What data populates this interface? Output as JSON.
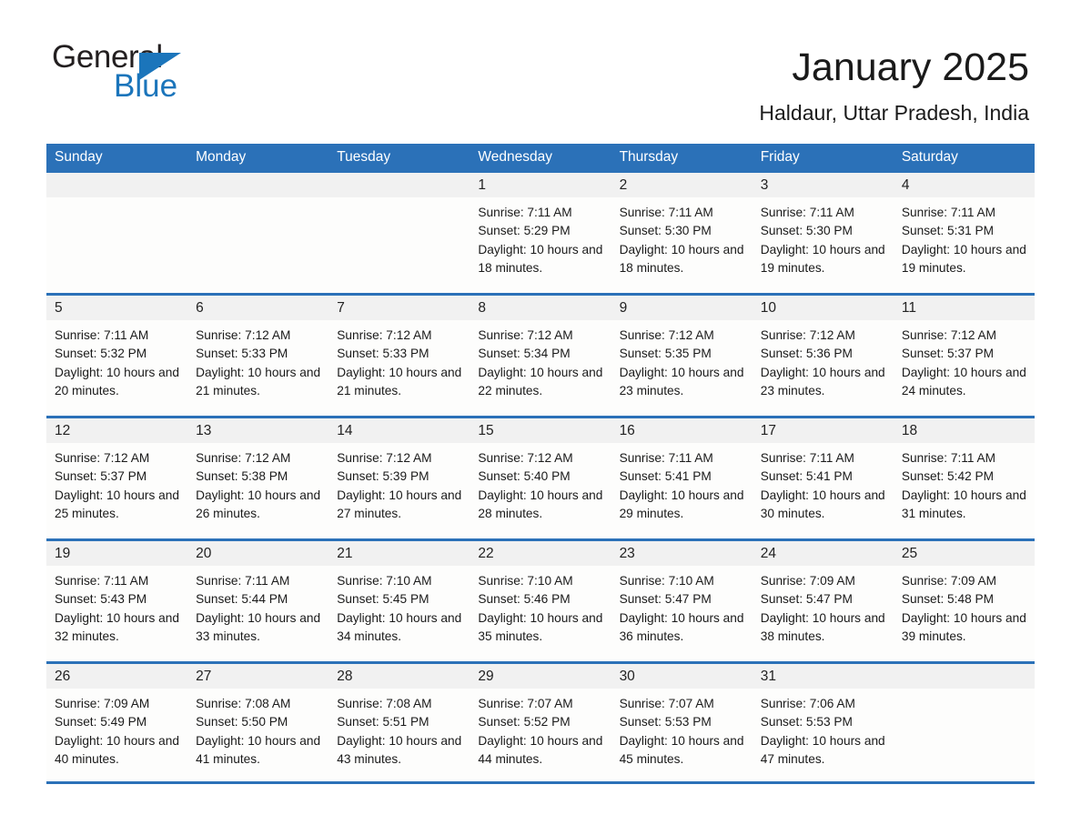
{
  "brand": {
    "name_part1": "General",
    "name_part2": "Blue",
    "logo_icon": "triangle-flag-icon",
    "accent_color": "#1b75bb"
  },
  "header": {
    "month_title": "January 2025",
    "location": "Haldaur, Uttar Pradesh, India"
  },
  "theme": {
    "header_bar_color": "#2b71b8",
    "date_band_color": "#f1f1f1",
    "cell_background": "#fdfdfc",
    "text_color": "#1a1a1a"
  },
  "weekdays": [
    "Sunday",
    "Monday",
    "Tuesday",
    "Wednesday",
    "Thursday",
    "Friday",
    "Saturday"
  ],
  "weeks": [
    [
      {
        "date": "",
        "empty": true
      },
      {
        "date": "",
        "empty": true
      },
      {
        "date": "",
        "empty": true
      },
      {
        "date": "1",
        "sunrise": "Sunrise: 7:11 AM",
        "sunset": "Sunset: 5:29 PM",
        "daylight": "Daylight: 10 hours and 18 minutes."
      },
      {
        "date": "2",
        "sunrise": "Sunrise: 7:11 AM",
        "sunset": "Sunset: 5:30 PM",
        "daylight": "Daylight: 10 hours and 18 minutes."
      },
      {
        "date": "3",
        "sunrise": "Sunrise: 7:11 AM",
        "sunset": "Sunset: 5:30 PM",
        "daylight": "Daylight: 10 hours and 19 minutes."
      },
      {
        "date": "4",
        "sunrise": "Sunrise: 7:11 AM",
        "sunset": "Sunset: 5:31 PM",
        "daylight": "Daylight: 10 hours and 19 minutes."
      }
    ],
    [
      {
        "date": "5",
        "sunrise": "Sunrise: 7:11 AM",
        "sunset": "Sunset: 5:32 PM",
        "daylight": "Daylight: 10 hours and 20 minutes."
      },
      {
        "date": "6",
        "sunrise": "Sunrise: 7:12 AM",
        "sunset": "Sunset: 5:33 PM",
        "daylight": "Daylight: 10 hours and 21 minutes."
      },
      {
        "date": "7",
        "sunrise": "Sunrise: 7:12 AM",
        "sunset": "Sunset: 5:33 PM",
        "daylight": "Daylight: 10 hours and 21 minutes."
      },
      {
        "date": "8",
        "sunrise": "Sunrise: 7:12 AM",
        "sunset": "Sunset: 5:34 PM",
        "daylight": "Daylight: 10 hours and 22 minutes."
      },
      {
        "date": "9",
        "sunrise": "Sunrise: 7:12 AM",
        "sunset": "Sunset: 5:35 PM",
        "daylight": "Daylight: 10 hours and 23 minutes."
      },
      {
        "date": "10",
        "sunrise": "Sunrise: 7:12 AM",
        "sunset": "Sunset: 5:36 PM",
        "daylight": "Daylight: 10 hours and 23 minutes."
      },
      {
        "date": "11",
        "sunrise": "Sunrise: 7:12 AM",
        "sunset": "Sunset: 5:37 PM",
        "daylight": "Daylight: 10 hours and 24 minutes."
      }
    ],
    [
      {
        "date": "12",
        "sunrise": "Sunrise: 7:12 AM",
        "sunset": "Sunset: 5:37 PM",
        "daylight": "Daylight: 10 hours and 25 minutes."
      },
      {
        "date": "13",
        "sunrise": "Sunrise: 7:12 AM",
        "sunset": "Sunset: 5:38 PM",
        "daylight": "Daylight: 10 hours and 26 minutes."
      },
      {
        "date": "14",
        "sunrise": "Sunrise: 7:12 AM",
        "sunset": "Sunset: 5:39 PM",
        "daylight": "Daylight: 10 hours and 27 minutes."
      },
      {
        "date": "15",
        "sunrise": "Sunrise: 7:12 AM",
        "sunset": "Sunset: 5:40 PM",
        "daylight": "Daylight: 10 hours and 28 minutes."
      },
      {
        "date": "16",
        "sunrise": "Sunrise: 7:11 AM",
        "sunset": "Sunset: 5:41 PM",
        "daylight": "Daylight: 10 hours and 29 minutes."
      },
      {
        "date": "17",
        "sunrise": "Sunrise: 7:11 AM",
        "sunset": "Sunset: 5:41 PM",
        "daylight": "Daylight: 10 hours and 30 minutes."
      },
      {
        "date": "18",
        "sunrise": "Sunrise: 7:11 AM",
        "sunset": "Sunset: 5:42 PM",
        "daylight": "Daylight: 10 hours and 31 minutes."
      }
    ],
    [
      {
        "date": "19",
        "sunrise": "Sunrise: 7:11 AM",
        "sunset": "Sunset: 5:43 PM",
        "daylight": "Daylight: 10 hours and 32 minutes."
      },
      {
        "date": "20",
        "sunrise": "Sunrise: 7:11 AM",
        "sunset": "Sunset: 5:44 PM",
        "daylight": "Daylight: 10 hours and 33 minutes."
      },
      {
        "date": "21",
        "sunrise": "Sunrise: 7:10 AM",
        "sunset": "Sunset: 5:45 PM",
        "daylight": "Daylight: 10 hours and 34 minutes."
      },
      {
        "date": "22",
        "sunrise": "Sunrise: 7:10 AM",
        "sunset": "Sunset: 5:46 PM",
        "daylight": "Daylight: 10 hours and 35 minutes."
      },
      {
        "date": "23",
        "sunrise": "Sunrise: 7:10 AM",
        "sunset": "Sunset: 5:47 PM",
        "daylight": "Daylight: 10 hours and 36 minutes."
      },
      {
        "date": "24",
        "sunrise": "Sunrise: 7:09 AM",
        "sunset": "Sunset: 5:47 PM",
        "daylight": "Daylight: 10 hours and 38 minutes."
      },
      {
        "date": "25",
        "sunrise": "Sunrise: 7:09 AM",
        "sunset": "Sunset: 5:48 PM",
        "daylight": "Daylight: 10 hours and 39 minutes."
      }
    ],
    [
      {
        "date": "26",
        "sunrise": "Sunrise: 7:09 AM",
        "sunset": "Sunset: 5:49 PM",
        "daylight": "Daylight: 10 hours and 40 minutes."
      },
      {
        "date": "27",
        "sunrise": "Sunrise: 7:08 AM",
        "sunset": "Sunset: 5:50 PM",
        "daylight": "Daylight: 10 hours and 41 minutes."
      },
      {
        "date": "28",
        "sunrise": "Sunrise: 7:08 AM",
        "sunset": "Sunset: 5:51 PM",
        "daylight": "Daylight: 10 hours and 43 minutes."
      },
      {
        "date": "29",
        "sunrise": "Sunrise: 7:07 AM",
        "sunset": "Sunset: 5:52 PM",
        "daylight": "Daylight: 10 hours and 44 minutes."
      },
      {
        "date": "30",
        "sunrise": "Sunrise: 7:07 AM",
        "sunset": "Sunset: 5:53 PM",
        "daylight": "Daylight: 10 hours and 45 minutes."
      },
      {
        "date": "31",
        "sunrise": "Sunrise: 7:06 AM",
        "sunset": "Sunset: 5:53 PM",
        "daylight": "Daylight: 10 hours and 47 minutes."
      },
      {
        "date": "",
        "empty": true
      }
    ]
  ]
}
